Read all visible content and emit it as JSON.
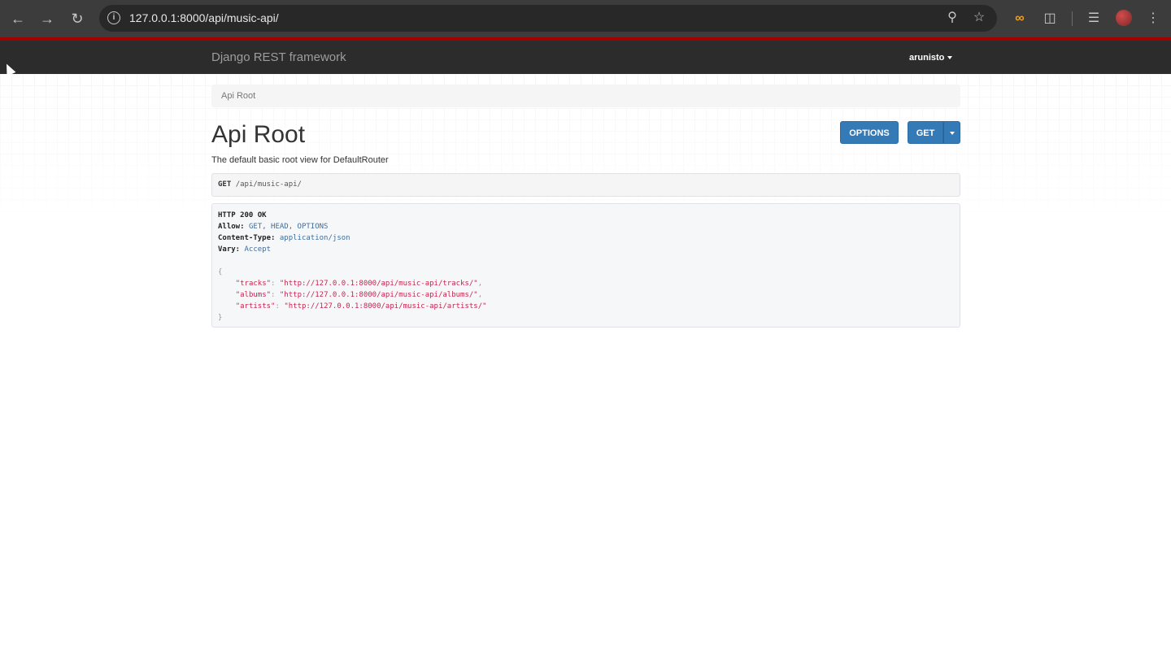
{
  "browser": {
    "url": "127.0.0.1:8000/api/music-api/",
    "icons": [
      "back-arrow-icon",
      "forward-arrow-icon",
      "reload-icon",
      "info-icon",
      "zoom-icon",
      "star-icon",
      "infinity-extension-icon",
      "puzzle-extensions-icon",
      "media-queue-icon",
      "profile-avatar",
      "kebab-menu-icon"
    ]
  },
  "navbar": {
    "brand": "Django REST framework",
    "user": "arunisto"
  },
  "breadcrumb": {
    "item": "Api Root"
  },
  "page": {
    "title": "Api Root",
    "description": "The default basic root view for DefaultRouter"
  },
  "buttons": {
    "options": "OPTIONS",
    "get": "GET"
  },
  "request": {
    "method": "GET",
    "path": "/api/music-api/"
  },
  "response": {
    "status": "HTTP 200 OK",
    "headers": [
      {
        "key": "Allow:",
        "value": "GET, HEAD, OPTIONS"
      },
      {
        "key": "Content-Type:",
        "value": "application/json"
      },
      {
        "key": "Vary:",
        "value": "Accept"
      }
    ],
    "open_brace": "{",
    "close_brace": "}",
    "body": [
      {
        "key": "\"tracks\"",
        "value": "\"http://127.0.0.1:8000/api/music-api/tracks/\"",
        "comma": ","
      },
      {
        "key": "\"albums\"",
        "value": "\"http://127.0.0.1:8000/api/music-api/albums/\"",
        "comma": ","
      },
      {
        "key": "\"artists\"",
        "value": "\"http://127.0.0.1:8000/api/music-api/artists/\"",
        "comma": ""
      }
    ]
  }
}
